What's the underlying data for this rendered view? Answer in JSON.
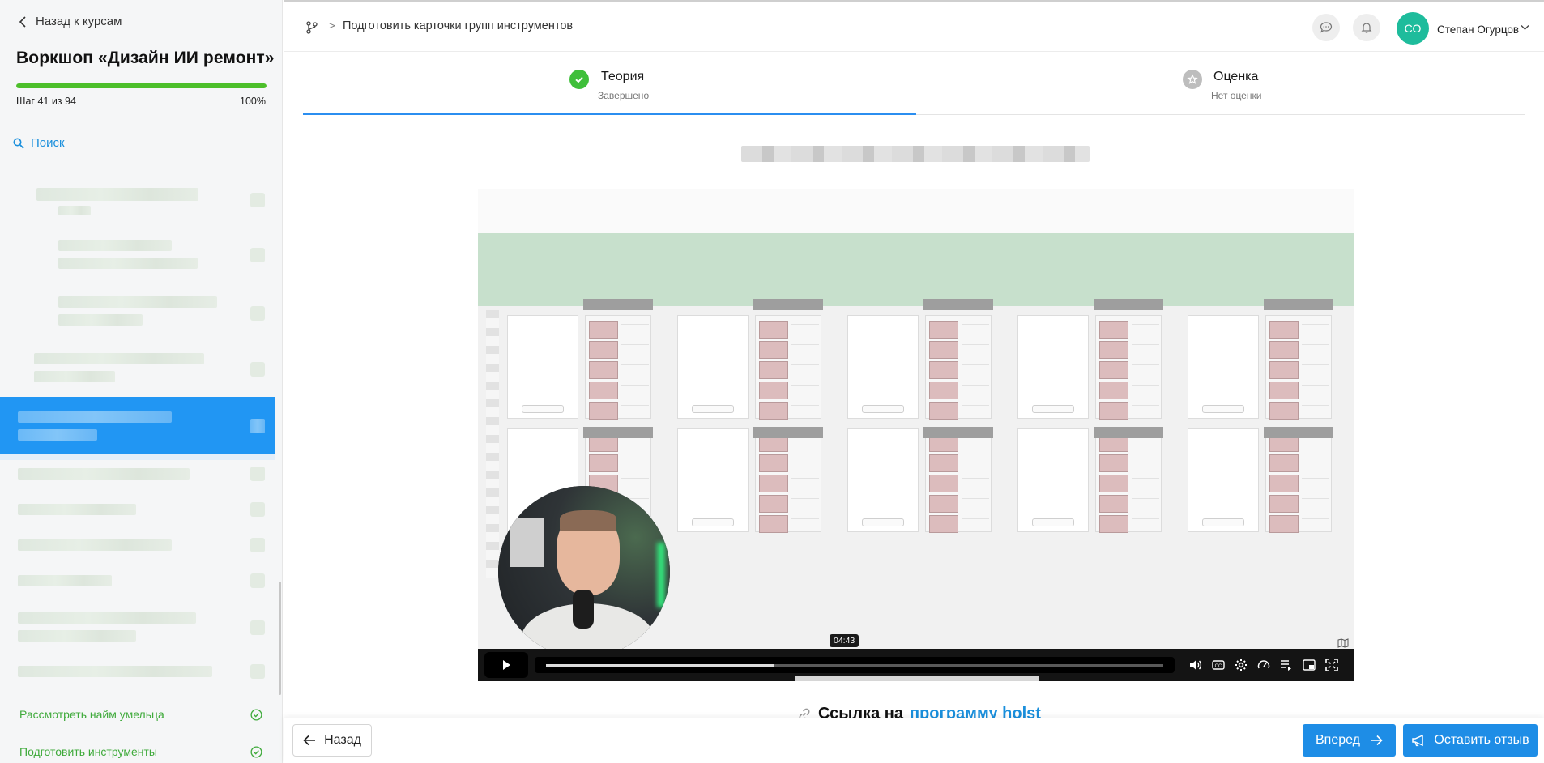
{
  "sidebar": {
    "back_label": "Назад к курсам",
    "course_title": "Воркшоп «Дизайн ИИ ремонт»",
    "progress": {
      "step_text": "Шаг 41 из 94",
      "percent_text": "100%",
      "fraction": 1.0
    },
    "search_label": "Поиск",
    "completed_items": [
      {
        "label": "Рассмотреть найм умельца"
      },
      {
        "label": "Подготовить инструменты"
      }
    ]
  },
  "header": {
    "breadcrumb_title": "Подготовить карточки групп инструментов",
    "breadcrumb_separator": ">",
    "avatar_initials": "СО",
    "user_name": "Степан Огурцов"
  },
  "tabs": [
    {
      "title": "Теория",
      "subtitle": "Завершено",
      "active": true
    },
    {
      "title": "Оценка",
      "subtitle": "Нет оценки",
      "active": false
    }
  ],
  "video": {
    "time_tooltip": "04:43",
    "played_fraction": 0.37
  },
  "content": {
    "link_prefix": "Ссылка на",
    "link_text": "программу holst"
  },
  "footer": {
    "back_label": "Назад",
    "next_label": "Вперед",
    "review_label": "Оставить отзыв"
  },
  "colors": {
    "accent": "#1e8de6",
    "progress": "#4cbf2a",
    "success": "#3faa3b",
    "avatar": "#1ebc9c",
    "active_item": "#2196f3"
  }
}
